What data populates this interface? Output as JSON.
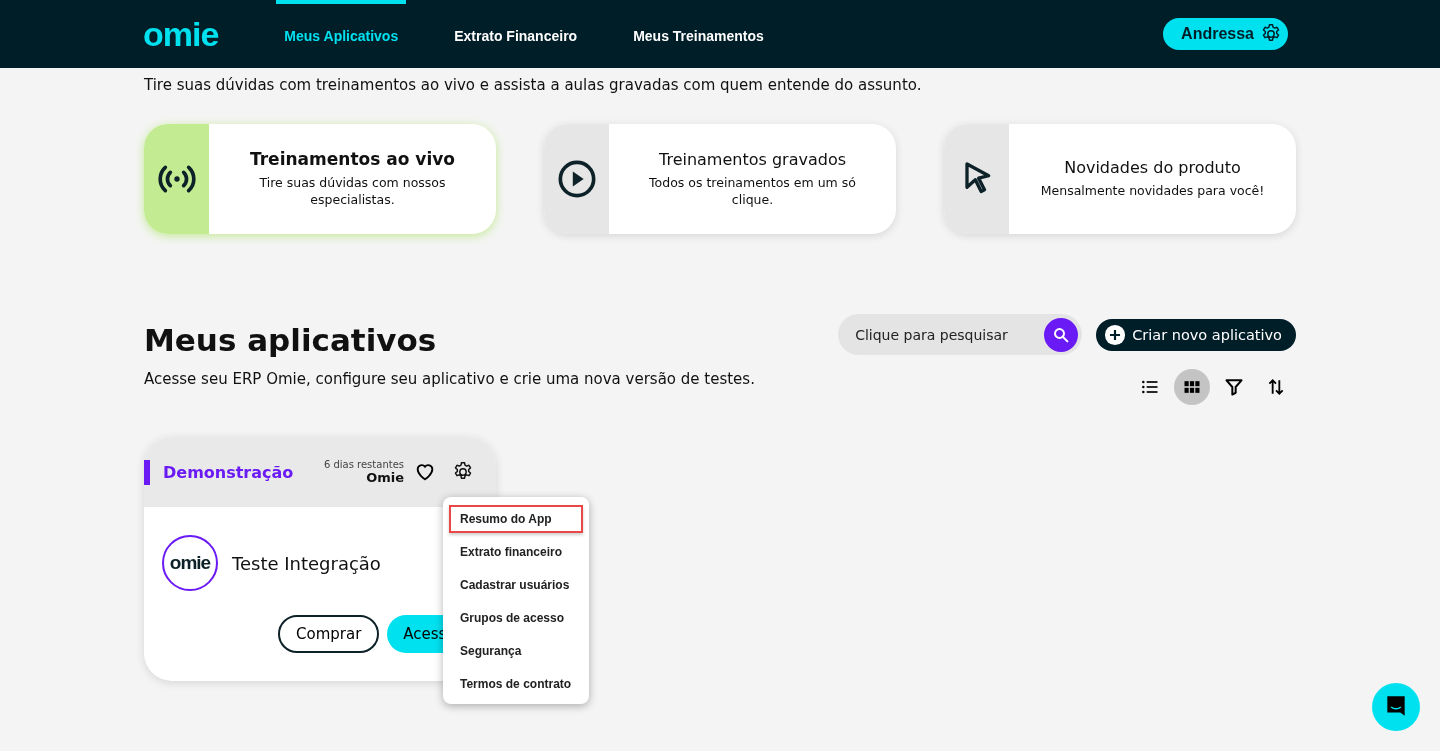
{
  "nav": {
    "logo": "omie",
    "links": [
      {
        "label": "Meus Aplicativos",
        "selected": true
      },
      {
        "label": "Extrato Financeiro",
        "selected": false
      },
      {
        "label": "Meus Treinamentos",
        "selected": false
      }
    ],
    "user": "Andressa"
  },
  "intro": "Tire suas dúvidas com treinamentos ao vivo e assista a aulas gravadas com quem entende do assunto.",
  "trainings": [
    {
      "kind": "live",
      "title": "Treinamentos ao vivo",
      "text": "Tire suas dúvidas com nossos especialistas.",
      "selected": true
    },
    {
      "kind": "recorded",
      "title": "Treinamentos gravados",
      "text": "Todos os treinamentos em um só clique.",
      "selected": false
    },
    {
      "kind": "news",
      "title": "Novidades do produto",
      "text": "Mensalmente novidades para você!",
      "selected": false
    }
  ],
  "apps": {
    "title": "Meus aplicativos",
    "subtitle": "Acesse seu ERP Omie, configure seu aplicativo e crie uma nova versão de testes.",
    "search": {
      "placeholder": "Clique para pesquisar"
    },
    "create": "Criar novo aplicativo",
    "views": [
      {
        "kind": "list",
        "selected": false
      },
      {
        "kind": "grid",
        "selected": true
      },
      {
        "kind": "filter",
        "selected": false
      },
      {
        "kind": "sort",
        "selected": false
      }
    ],
    "cards": [
      {
        "status": "Demonstração",
        "remaining": "6 dias restantes",
        "owner": "Omie",
        "logo": "omie",
        "name": "Teste Integração",
        "buy": "Comprar",
        "access": "Acess",
        "menu": [
          {
            "label": "Resumo do App",
            "selected": true
          },
          {
            "label": "Extrato financeiro",
            "selected": false
          },
          {
            "label": "Cadastrar usuários",
            "selected": false
          },
          {
            "label": "Grupos de acesso",
            "selected": false
          },
          {
            "label": "Segurança",
            "selected": false
          },
          {
            "label": "Termos de contrato",
            "selected": false
          }
        ]
      }
    ]
  }
}
